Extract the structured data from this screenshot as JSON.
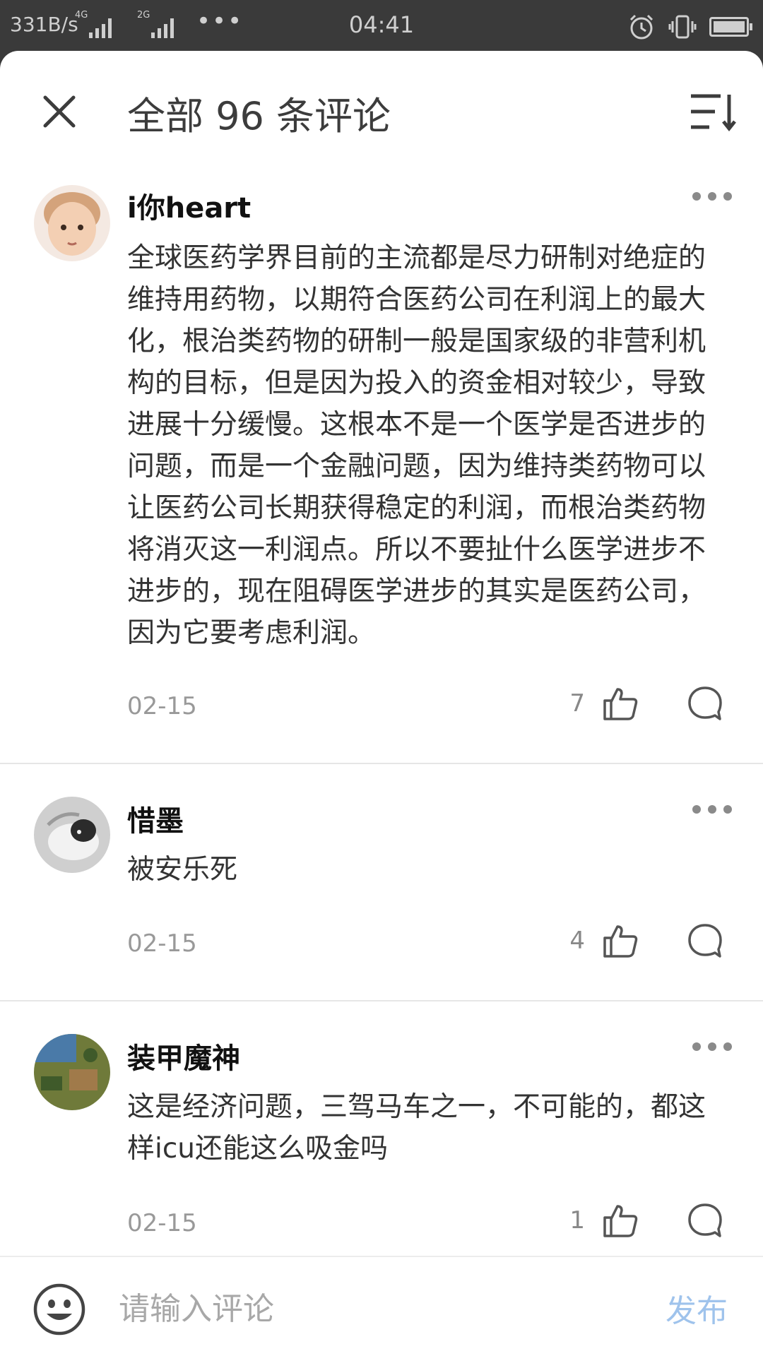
{
  "status_bar": {
    "net_speed": "331B/s",
    "signal_1_label": "4G",
    "signal_2_label": "2G",
    "overflow": "•••",
    "time": "04:41",
    "icons": [
      "alarm-icon",
      "vibrate-icon",
      "battery-icon"
    ]
  },
  "header": {
    "title": "全部 96 条评论",
    "close_icon": "close-icon",
    "sort_icon": "sort-icon"
  },
  "comments": [
    {
      "username": "i你heart",
      "content": "全球医药学界目前的主流都是尽力研制对绝症的维持用药物，以期符合医药公司在利润上的最大化，根治类药物的研制一般是国家级的非营利机构的目标，但是因为投入的资金相对较少，导致进展十分缓慢。这根本不是一个医学是否进步的问题，而是一个金融问题，因为维持类药物可以让医药公司长期获得稳定的利润，而根治类药物将消灭这一利润点。所以不要扯什么医学进步不进步的，现在阻碍医学进步的其实是医药公司，因为它要考虑利润。",
      "date": "02-15",
      "likes": "7"
    },
    {
      "username": "惜墨",
      "content": "被安乐死",
      "date": "02-15",
      "likes": "4"
    },
    {
      "username": "装甲魔神",
      "content": "这是经济问题，三驾马车之一，不可能的，都这样icu还能这么吸金吗",
      "date": "02-15",
      "likes": "1"
    }
  ],
  "input_bar": {
    "placeholder": "请输入评论",
    "publish_label": "发布",
    "emoji_icon": "emoji-icon"
  },
  "colors": {
    "accent_disabled": "#9fc3ec",
    "status_bar_bg": "#3a3a3a",
    "text_secondary": "#999999"
  }
}
